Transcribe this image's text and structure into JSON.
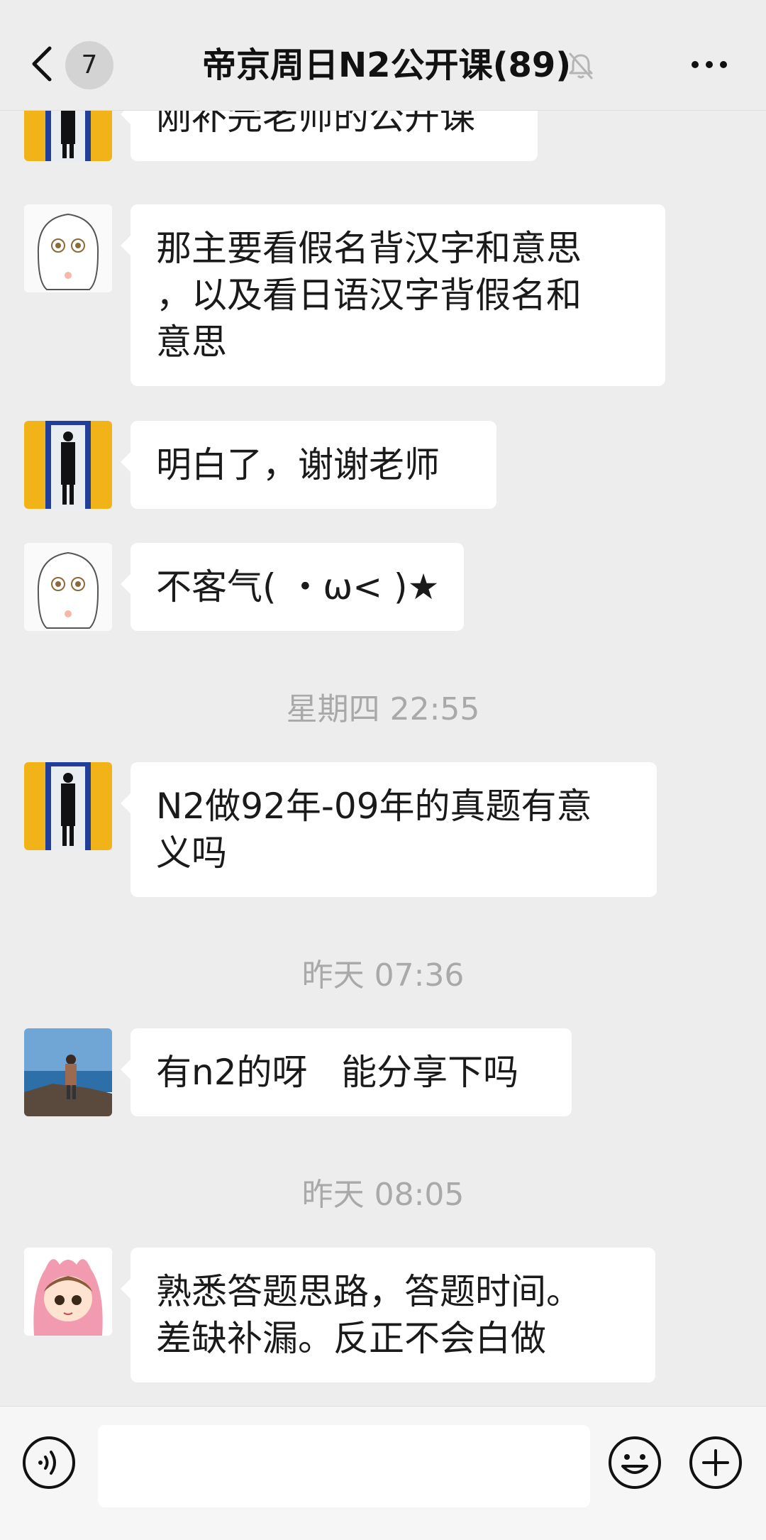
{
  "header": {
    "back_icon": "chevron-left-icon",
    "unread_count": "7",
    "title": "帝京周日N2公开课(89)",
    "mute_icon": "bell-mute-icon",
    "more_icon": "more-dots-icon"
  },
  "messages": [
    {
      "avatar": "avatar-yellow-door",
      "lines": [
        "刚补完老师的公开课"
      ]
    },
    {
      "avatar": "avatar-anime-girl",
      "lines": [
        "那主要看假名背汉字和意思",
        "，以及看日语汉字背假名和",
        "意思"
      ]
    },
    {
      "avatar": "avatar-yellow-door",
      "lines": [
        "明白了，谢谢老师"
      ]
    },
    {
      "avatar": "avatar-anime-girl",
      "lines": [
        "不客气( ・ω< )★"
      ]
    },
    {
      "timestamp": "星期四 22:55"
    },
    {
      "avatar": "avatar-yellow-door",
      "lines": [
        "N2做92年-09年的真题有意",
        "义吗"
      ]
    },
    {
      "timestamp": "昨天 07:36"
    },
    {
      "avatar": "avatar-seaside-person",
      "lines": [
        "有n2的呀   能分享下吗"
      ]
    },
    {
      "timestamp": "昨天 08:05"
    },
    {
      "avatar": "avatar-pink-bunny",
      "lines": [
        "熟悉答题思路，答题时间。",
        "差缺补漏。反正不会白做"
      ]
    }
  ],
  "input_bar": {
    "voice_icon": "voice-icon",
    "input_value": "",
    "emoji_icon": "emoji-icon",
    "plus_icon": "plus-circle-icon"
  },
  "colors": {
    "background": "#ededed",
    "bubble": "#ffffff",
    "timestamp": "#a9a9a9",
    "avatar_yellow": "#f2b319",
    "avatar_door_blue": "#1f3f9a"
  }
}
